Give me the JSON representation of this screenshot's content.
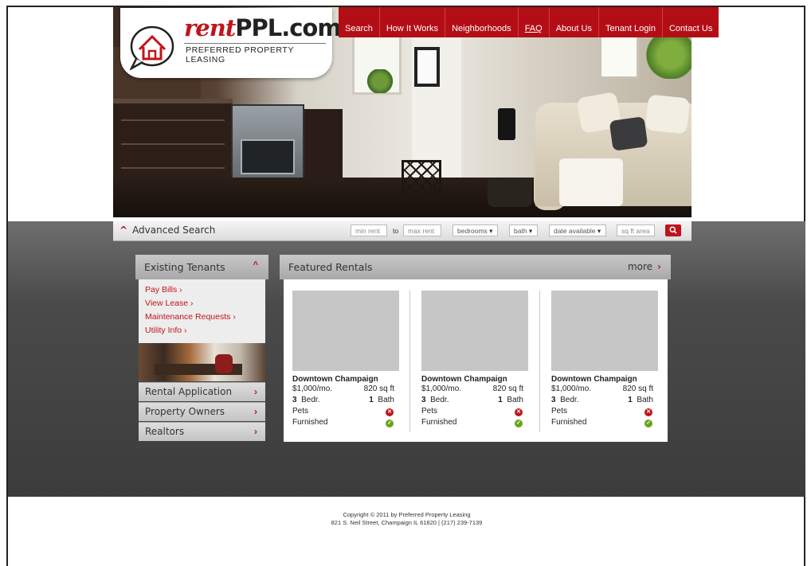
{
  "logo": {
    "brand_prefix": "rent",
    "brand_suffix": "PPL.com",
    "tagline": "PREFERRED PROPERTY LEASING"
  },
  "nav": {
    "items": [
      "Search",
      "How It Works",
      "Neighborhoods",
      "FAQ",
      "About Us",
      "Tenant Login",
      "Contact Us"
    ],
    "active": "FAQ"
  },
  "search": {
    "title": "Advanced Search",
    "min_rent_placeholder": "min rent",
    "to_label": "to",
    "max_rent_placeholder": "max rent",
    "bedrooms": "bedrooms",
    "bath": "bath",
    "date_available": "date available",
    "sqft_placeholder": "sq ft area"
  },
  "sidebar": {
    "heading": "Existing Tenants",
    "links": [
      "Pay Bills ›",
      "View Lease ›",
      "Maintenance Requests ›",
      "Utility Info ›"
    ],
    "sections": [
      "Rental Application",
      "Property Owners",
      "Realtors"
    ]
  },
  "featured": {
    "heading": "Featured Rentals",
    "more_label": "more",
    "cards": [
      {
        "title": "Downtown Champaign",
        "price": "$1,000/mo.",
        "sqft": "820 sq ft",
        "beds_num": "3",
        "beds_label": "Bedr.",
        "bath_num": "1",
        "bath_label": "Bath",
        "pets_label": "Pets",
        "pets": false,
        "furnished_label": "Furnished",
        "furnished": true
      },
      {
        "title": "Downtown Champaign",
        "price": "$1,000/mo.",
        "sqft": "820 sq ft",
        "beds_num": "3",
        "beds_label": "Bedr.",
        "bath_num": "1",
        "bath_label": "Bath",
        "pets_label": "Pets",
        "pets": false,
        "furnished_label": "Furnished",
        "furnished": true
      },
      {
        "title": "Downtown Champaign",
        "price": "$1,000/mo.",
        "sqft": "820 sq ft",
        "beds_num": "3",
        "beds_label": "Bedr.",
        "bath_num": "1",
        "bath_label": "Bath",
        "pets_label": "Pets",
        "pets": false,
        "furnished_label": "Furnished",
        "furnished": true
      }
    ]
  },
  "footer": {
    "copyright": "Copyright © 2011 by Preferred Property Leasing",
    "address": "821 S. Neil Street, Champaign IL 61820 | (217) 239-7139"
  },
  "colors": {
    "accent": "#b30e16",
    "ok": "#6aa418",
    "dark_band": "#3c3c3c"
  },
  "icons": [
    "house-icon",
    "caret-up-icon",
    "chevron-right-icon",
    "search-icon",
    "close-circle-icon",
    "check-circle-icon"
  ]
}
